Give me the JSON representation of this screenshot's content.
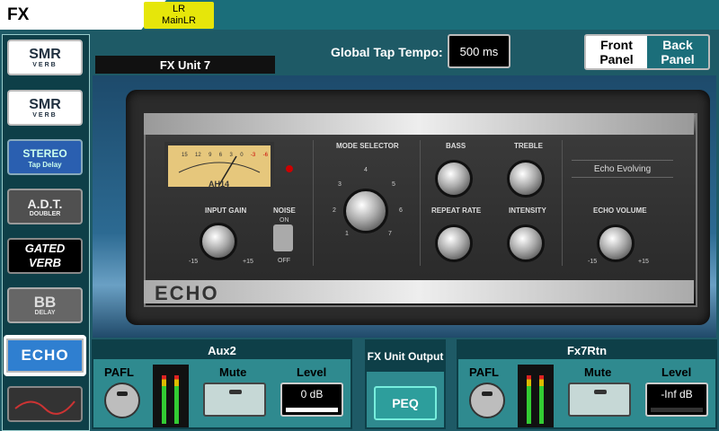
{
  "header": {
    "title": "FX",
    "route_line1": "LR",
    "route_line2": "MainLR"
  },
  "sidebar": {
    "items": [
      {
        "title": "SMR",
        "subtitle": "VERB"
      },
      {
        "title": "SMR",
        "subtitle": "VERB"
      },
      {
        "title": "STEREO",
        "subtitle": "Tap Delay"
      },
      {
        "title": "A.D.T.",
        "subtitle": "DOUBLER"
      },
      {
        "title": "GATED",
        "subtitle": "VERB"
      },
      {
        "title": "BB",
        "subtitle": "DELAY"
      },
      {
        "title": "ECHO",
        "subtitle": ""
      }
    ]
  },
  "tap_tempo": {
    "label": "Global Tap Tempo:",
    "value": "500 ms"
  },
  "panel_toggle": {
    "front": "Front Panel",
    "back": "Back Panel"
  },
  "unit": {
    "label": "FX Unit 7"
  },
  "device": {
    "brand": "ECHO",
    "meter_label": "AH14",
    "meter_scale": [
      "15",
      "12",
      "9",
      "6",
      "3",
      "0",
      "-3",
      "-6"
    ],
    "mode_selector": {
      "label": "MODE SELECTOR",
      "positions": [
        "1",
        "2",
        "3",
        "4",
        "5",
        "6",
        "7"
      ]
    },
    "input_gain": {
      "label": "INPUT GAIN",
      "min": "-15",
      "max": "+15"
    },
    "noise": {
      "label": "NOISE",
      "on": "ON",
      "off": "OFF"
    },
    "bass": {
      "label": "BASS"
    },
    "treble": {
      "label": "TREBLE"
    },
    "repeat_rate": {
      "label": "REPEAT RATE"
    },
    "intensity": {
      "label": "INTENSITY"
    },
    "echo_volume": {
      "label": "ECHO VOLUME",
      "min": "-15",
      "max": "+15"
    },
    "preset_name": "Echo Evolving"
  },
  "input_strip": {
    "name": "Aux2",
    "pafl": "PAFL",
    "mute": "Mute",
    "level_label": "Level",
    "level_value": "0 dB"
  },
  "fx_output": {
    "title": "FX Unit Output",
    "peq": "PEQ"
  },
  "return_strip": {
    "name": "Fx7Rtn",
    "pafl": "PAFL",
    "mute": "Mute",
    "level_label": "Level",
    "level_value": "-Inf dB"
  },
  "colors": {
    "accent": "#1b6e7a",
    "badge": "#e6e60a",
    "panel": "#2f8a8f"
  }
}
